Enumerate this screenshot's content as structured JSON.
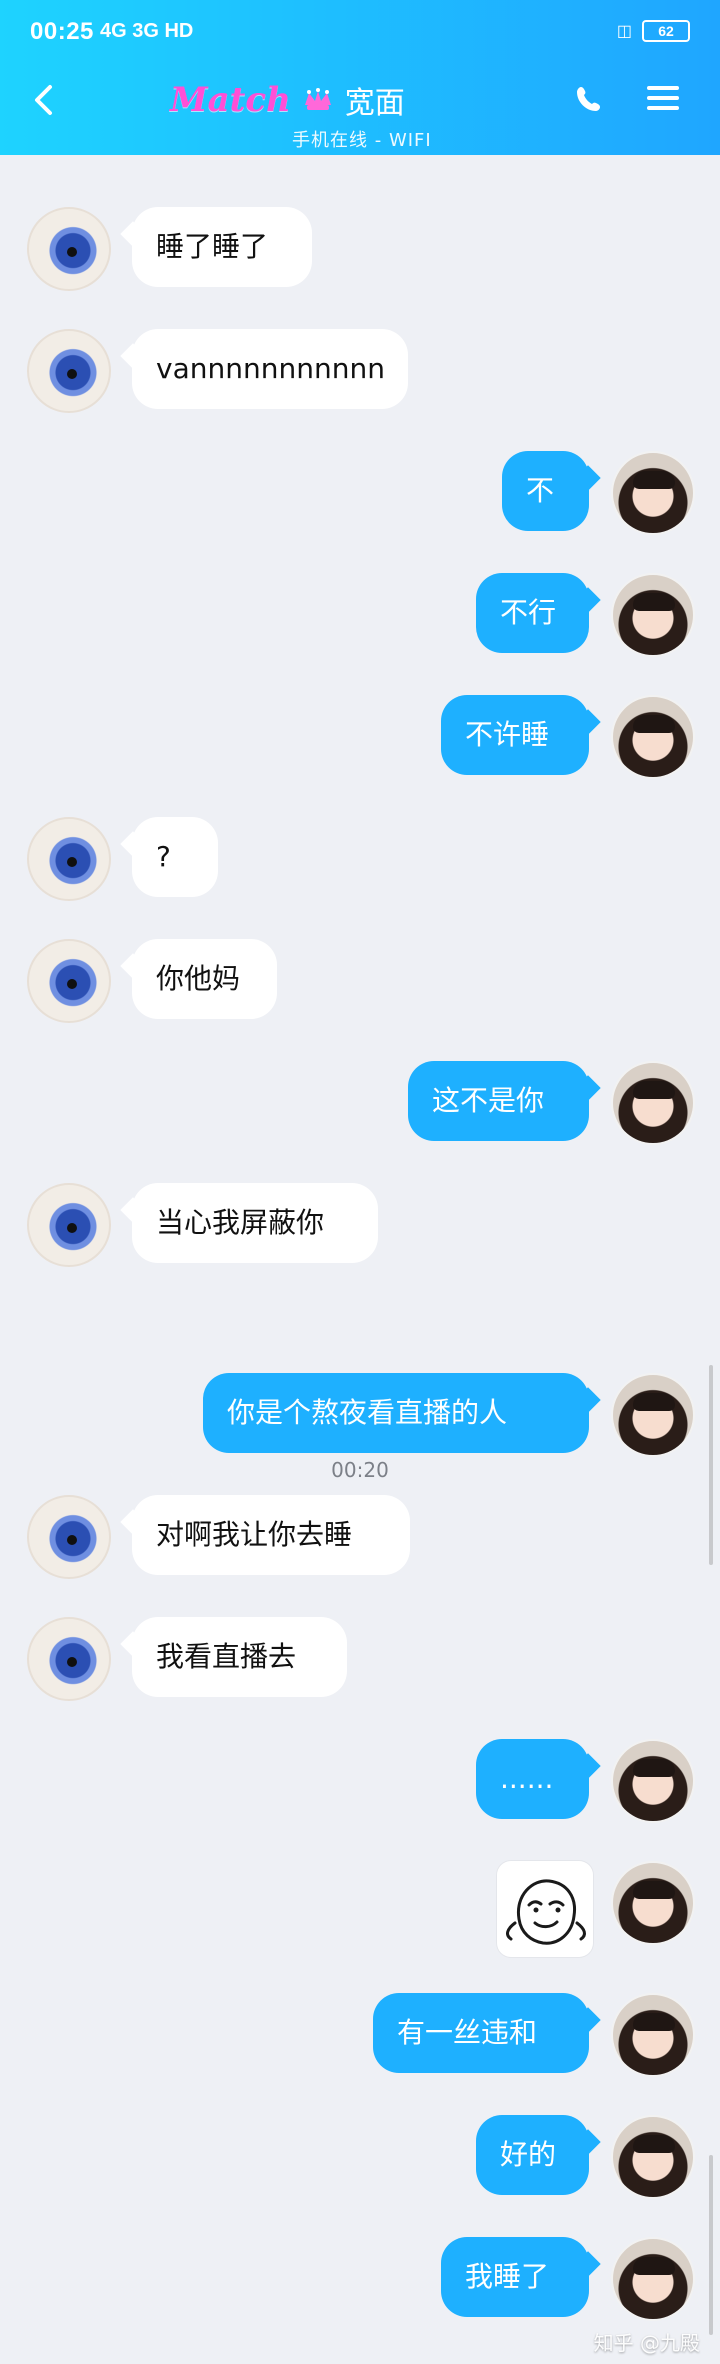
{
  "status_bar": {
    "time": "00:25",
    "network": "4G 3G HD",
    "battery": "62"
  },
  "header": {
    "brand": "Match",
    "contact_name": "宽面",
    "contact_status": "手机在线 - WIFI"
  },
  "messages": [
    {
      "side": "left",
      "text": "睡了睡了"
    },
    {
      "side": "left",
      "text": "vannnnnnnnnnn"
    },
    {
      "side": "right",
      "text": "不"
    },
    {
      "side": "right",
      "text": "不行"
    },
    {
      "side": "right",
      "text": "不许睡"
    },
    {
      "side": "left",
      "text": "?"
    },
    {
      "side": "left",
      "text": "你他妈"
    },
    {
      "side": "right",
      "text": "这不是你"
    },
    {
      "side": "left",
      "text": "当心我屏蔽你"
    },
    {
      "side": "right",
      "text": "你是个熬夜看直播的人"
    },
    {
      "side": "left",
      "text": "对啊我让你去睡"
    },
    {
      "side": "left",
      "text": "我看直播去"
    },
    {
      "side": "right",
      "text": "......"
    },
    {
      "side": "right",
      "text": ""
    },
    {
      "side": "right",
      "text": "有一丝违和"
    },
    {
      "side": "right",
      "text": "好的"
    },
    {
      "side": "right",
      "text": "我睡了"
    }
  ],
  "timestamp": "00:20",
  "watermark": "知乎 @九殿",
  "icons": {
    "back": "chevron-left-icon",
    "call": "phone-icon",
    "menu": "menu-icon",
    "crown": "crown-icon",
    "sticker": "smiley-sticker-icon"
  },
  "colors": {
    "header_start": "#1ed3ff",
    "header_end": "#1fa6ff",
    "bubble_right": "#1eb0ff",
    "bubble_left": "#ffffff",
    "background": "#eef0f5"
  }
}
